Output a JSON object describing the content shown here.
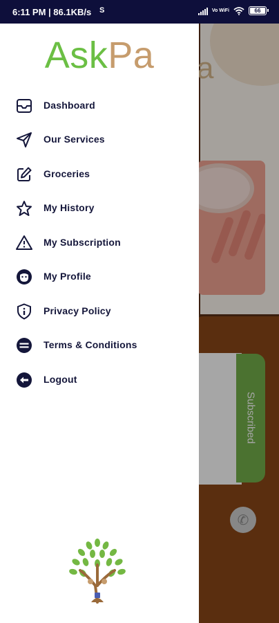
{
  "status_bar": {
    "time_speed": "6:11 PM | 86.1KB/s",
    "network_label": "Vo WiFi",
    "battery": "66"
  },
  "brand": {
    "part1": "Ask",
    "part2": "Pa",
    "color1": "#6bbf44",
    "color2": "#c69c6d"
  },
  "menu": {
    "items": [
      {
        "label": "Dashboard",
        "icon": "inbox-icon"
      },
      {
        "label": "Our Services",
        "icon": "send-icon"
      },
      {
        "label": "Groceries",
        "icon": "edit-icon"
      },
      {
        "label": "My History",
        "icon": "star-icon"
      },
      {
        "label": "My Subscription",
        "icon": "warning-icon"
      },
      {
        "label": "My Profile",
        "icon": "profile-face-icon"
      },
      {
        "label": "Privacy Policy",
        "icon": "shield-info-icon"
      },
      {
        "label": "Terms & Conditions",
        "icon": "minus-circle-icon"
      },
      {
        "label": "Logout",
        "icon": "logout-arrow-icon"
      }
    ]
  },
  "background": {
    "subscribed_label": "Subscribed",
    "letter": "a"
  },
  "colors": {
    "status_bar": "#0e0f3b",
    "menu_text": "#14163a",
    "subscribed": "#73b04a",
    "brown": "#8a4717"
  }
}
